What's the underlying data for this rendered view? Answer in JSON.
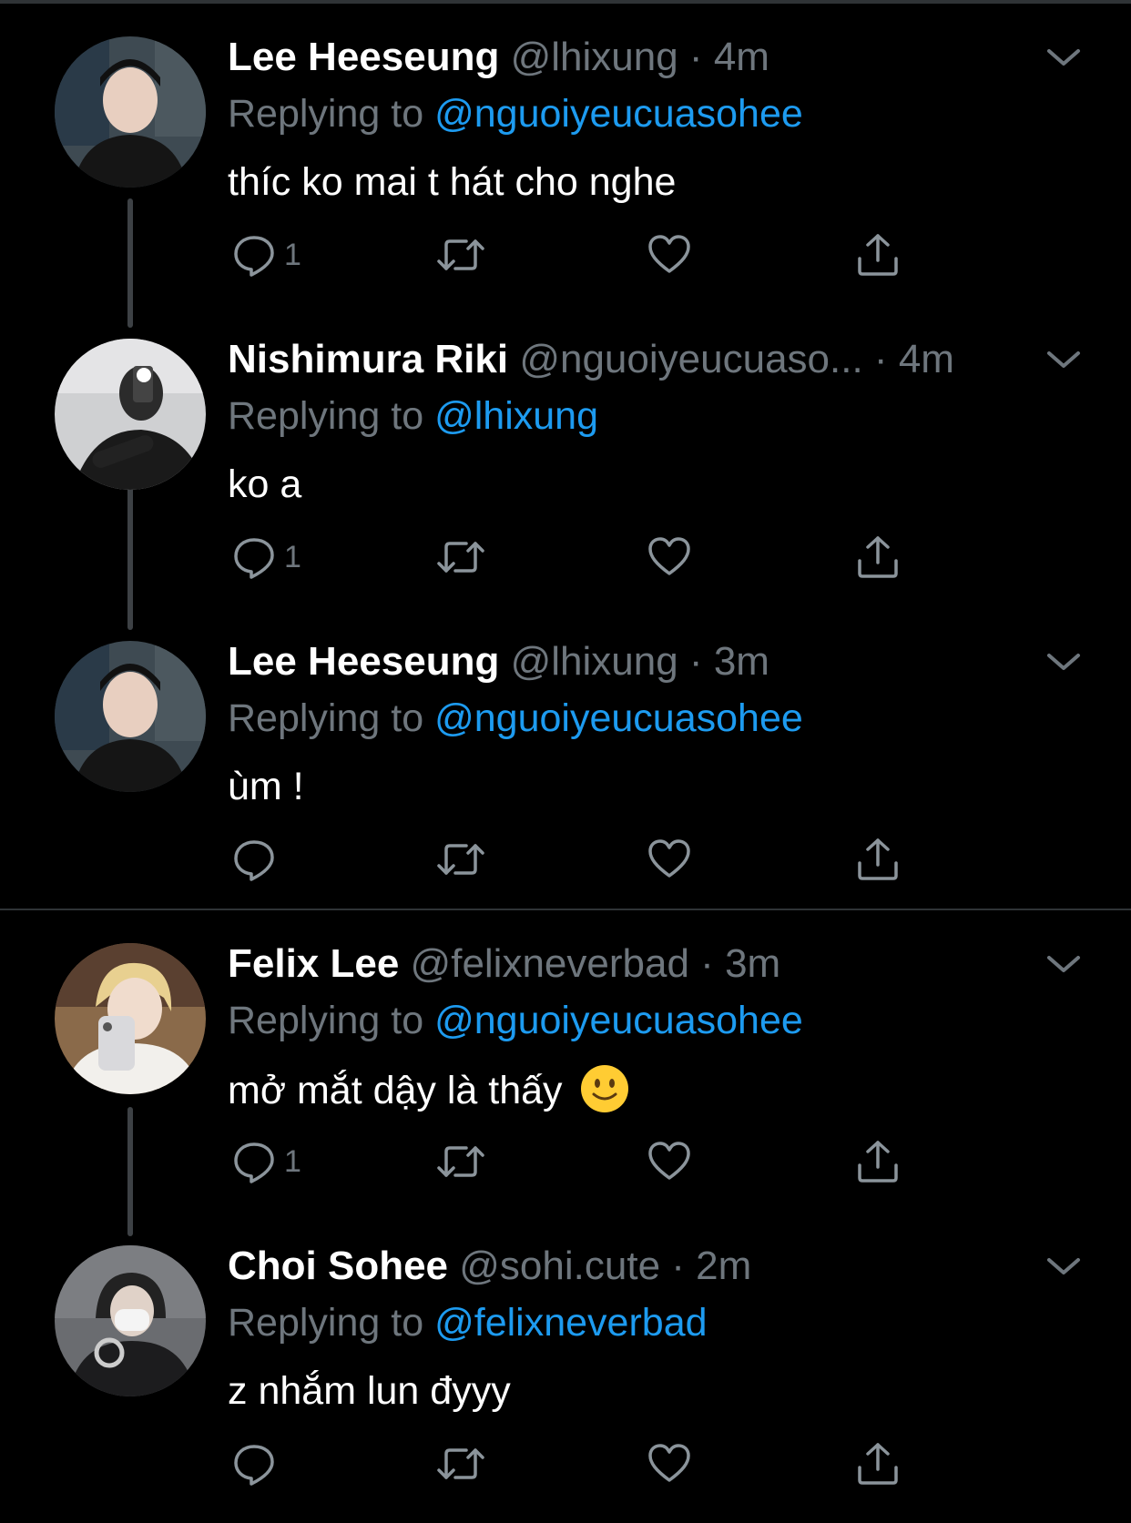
{
  "tweets": [
    {
      "name": "Lee Heeseung",
      "handle": "@lhixung",
      "dot": "·",
      "time": "4m",
      "replying_prefix": "Replying to",
      "replying_to": "@nguoiyeucuasohee",
      "text": "thíc ko mai t hát cho nghe",
      "reply_count": "1",
      "avatar_icon": "avatar-photo"
    },
    {
      "name": "Nishimura Riki",
      "handle": "@nguoiyeucuaso...",
      "dot": "·",
      "time": "4m",
      "replying_prefix": "Replying to",
      "replying_to": "@lhixung",
      "text": "ko a",
      "reply_count": "1",
      "avatar_icon": "avatar-photo"
    },
    {
      "name": "Lee Heeseung",
      "handle": "@lhixung",
      "dot": "·",
      "time": "3m",
      "replying_prefix": "Replying to",
      "replying_to": "@nguoiyeucuasohee",
      "text": "ùm !",
      "reply_count": "",
      "avatar_icon": "avatar-photo"
    },
    {
      "name": "Felix Lee",
      "handle": "@felixneverbad",
      "dot": "·",
      "time": "3m",
      "replying_prefix": "Replying to",
      "replying_to": "@nguoiyeucuasohee",
      "text": "mở mắt dậy là thấy",
      "emoji": "slightly-smiling-face",
      "reply_count": "1",
      "avatar_icon": "avatar-photo"
    },
    {
      "name": "Choi Sohee",
      "handle": "@sohi.cute",
      "dot": "·",
      "time": "2m",
      "replying_prefix": "Replying to",
      "replying_to": "@felixneverbad",
      "text": "z nhắm lun đyyy",
      "reply_count": "",
      "avatar_icon": "avatar-photo"
    }
  ],
  "icons": {
    "reply": "reply-icon",
    "retweet": "retweet-icon",
    "like": "heart-icon",
    "share": "share-icon",
    "more": "chevron-down-icon"
  },
  "colors": {
    "background": "#000000",
    "secondary_text": "#6e767d",
    "mention": "#1d9bf0",
    "thread_line": "#3d4145"
  }
}
